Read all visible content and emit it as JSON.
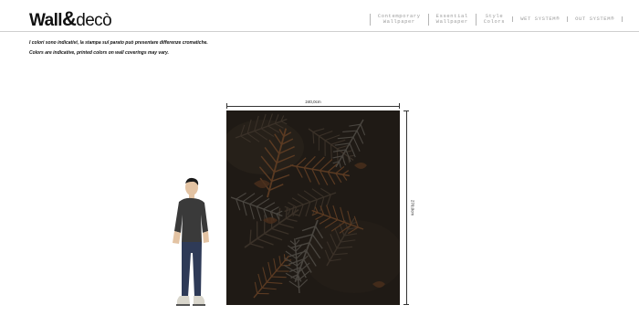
{
  "header": {
    "logo": {
      "word1": "Wall",
      "amp": "&",
      "word2": "decò"
    },
    "nav": [
      {
        "line1": "Contemporary",
        "line2": "Wallpaper"
      },
      {
        "line1": "Essential",
        "line2": "Wallpaper"
      },
      {
        "line1": "Style",
        "line2": "Colors"
      },
      {
        "line1": "WET SYSTEM®",
        "line2": ""
      },
      {
        "line1": "OUT SYSTEM®",
        "line2": ""
      }
    ]
  },
  "notes": {
    "italian": "I colori sono indicativi, la stampa sul parato può presentare differenze cromatiche.",
    "english": "Colors are indicative, printed colors on wall coverings may vary."
  },
  "preview": {
    "width_label": "240,0cm",
    "height_label": "270,0cm",
    "wallpaper_colors": {
      "base": "#1f1a15",
      "leaf_dark": "#2b2620",
      "leaf_mid": "#3a3128",
      "leaf_rust": "#5a3a22",
      "leaf_gray": "#4a4640"
    },
    "person_colors": {
      "shirt": "#3a3a3a",
      "jeans": "#2e3a57",
      "skin": "#e3c3a3",
      "hair": "#1a1a1a",
      "shoes": "#d9d6cc"
    }
  }
}
